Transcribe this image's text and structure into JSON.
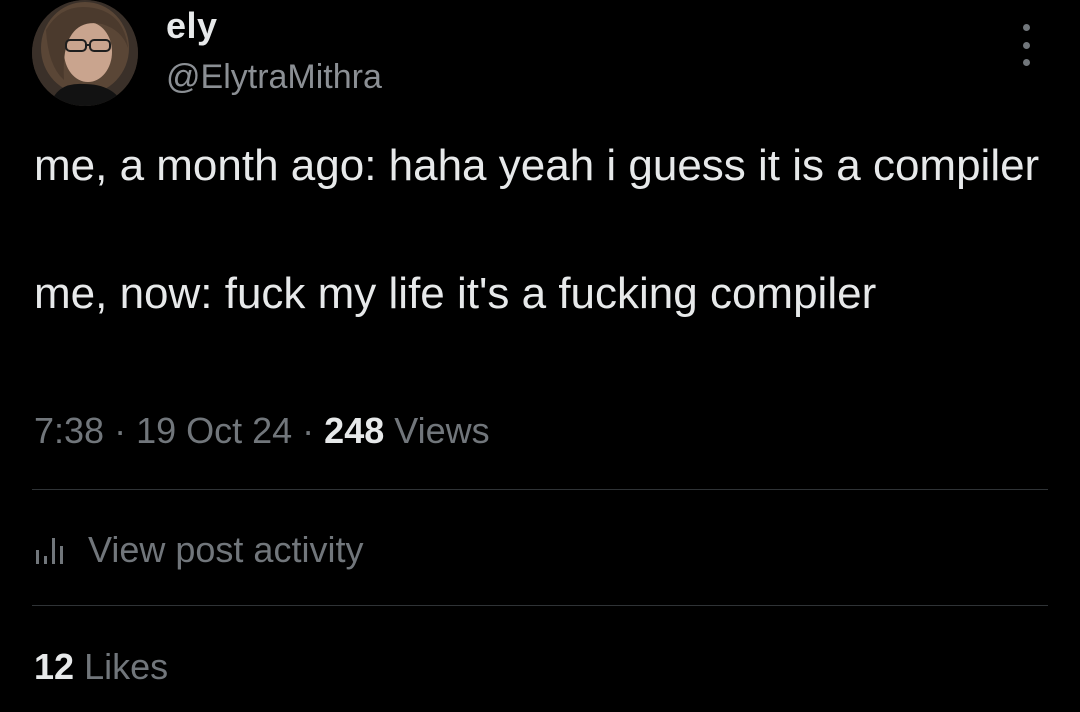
{
  "author": {
    "display_name": "ely",
    "handle": "@ElytraMithra",
    "avatar_icon": "profile-photo"
  },
  "post": {
    "lines": [
      "me, a month ago: haha yeah i guess it is a compiler",
      "me, now: fuck my life it's a fucking compiler"
    ]
  },
  "meta": {
    "time": "7:38",
    "separator": " · ",
    "date": "19 Oct 24",
    "views_count": "248",
    "views_label": "Views"
  },
  "activity": {
    "label": "View post activity",
    "icon": "bar-chart-icon"
  },
  "likes": {
    "count": "12",
    "label": "Likes"
  },
  "colors": {
    "background": "#000000",
    "primary_text": "#e7e9ea",
    "secondary_text": "#71767b",
    "divider": "#2f3336"
  }
}
